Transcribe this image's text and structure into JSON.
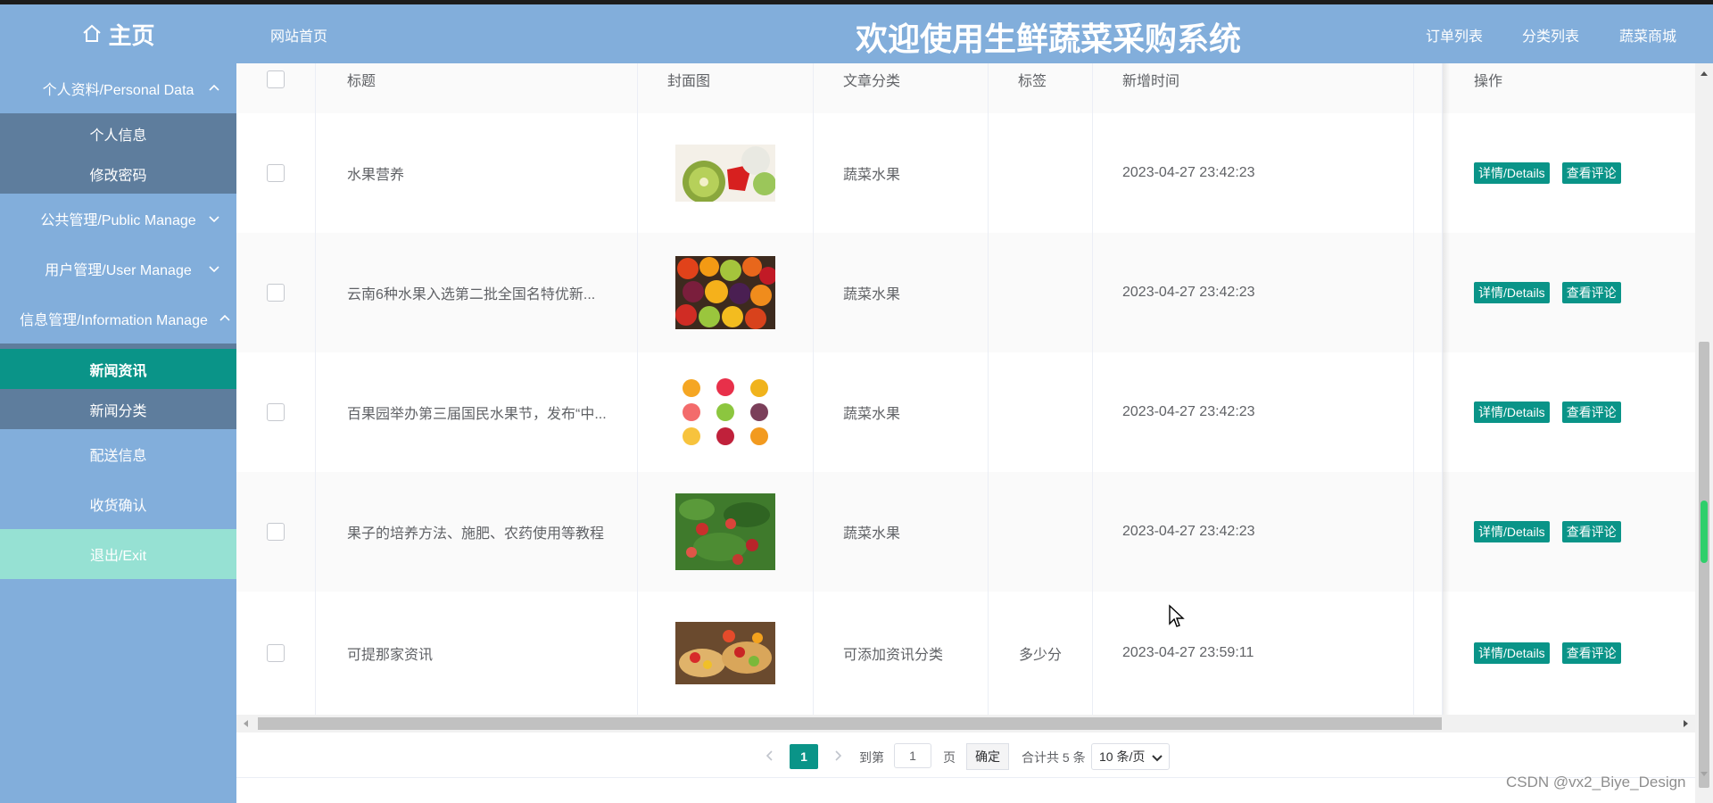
{
  "header": {
    "home_label": "主页",
    "site_home": "网站首页",
    "title": "欢迎使用生鲜蔬菜采购系统",
    "nav": [
      "订单列表",
      "分类列表",
      "蔬菜商城"
    ]
  },
  "sidebar": {
    "personal": "个人资料/Personal Data",
    "personal_items": [
      "个人信息",
      "修改密码"
    ],
    "public": "公共管理/Public Manage",
    "user": "用户管理/User Manage",
    "info": "信息管理/Information Manage",
    "info_items": [
      "新闻资讯",
      "新闻分类"
    ],
    "delivery": "配送信息",
    "receipt": "收货确认",
    "exit": "退出/Exit"
  },
  "table": {
    "header_cols": [
      "标题",
      "封面图",
      "文章分类",
      "标签",
      "新增时间",
      "操作"
    ],
    "rows": [
      {
        "title": "水果营养",
        "category": "蔬菜水果",
        "tag": "",
        "time": "2023-04-27 23:42:23"
      },
      {
        "title": "云南6种水果入选第二批全国名特优新...",
        "category": "蔬菜水果",
        "tag": "",
        "time": "2023-04-27 23:42:23"
      },
      {
        "title": "百果园举办第三届国民水果节，发布“中...",
        "category": "蔬菜水果",
        "tag": "",
        "time": "2023-04-27 23:42:23"
      },
      {
        "title": "果子的培养方法、施肥、农药使用等教程",
        "category": "蔬菜水果",
        "tag": "",
        "time": "2023-04-27 23:42:23"
      },
      {
        "title": "可提那家资讯",
        "category": "可添加资讯分类",
        "tag": "多少分",
        "time": "2023-04-27 23:59:11"
      }
    ],
    "btn_details": "详情/Details",
    "btn_comments": "查看评论"
  },
  "pagination": {
    "current": "1",
    "goto_label": "到第",
    "page_input": "1",
    "page_unit": "页",
    "confirm": "确定",
    "total": "合计共 5 条",
    "page_size": "10 条/页"
  },
  "watermark": "CSDN @vx2_Biye_Design"
}
